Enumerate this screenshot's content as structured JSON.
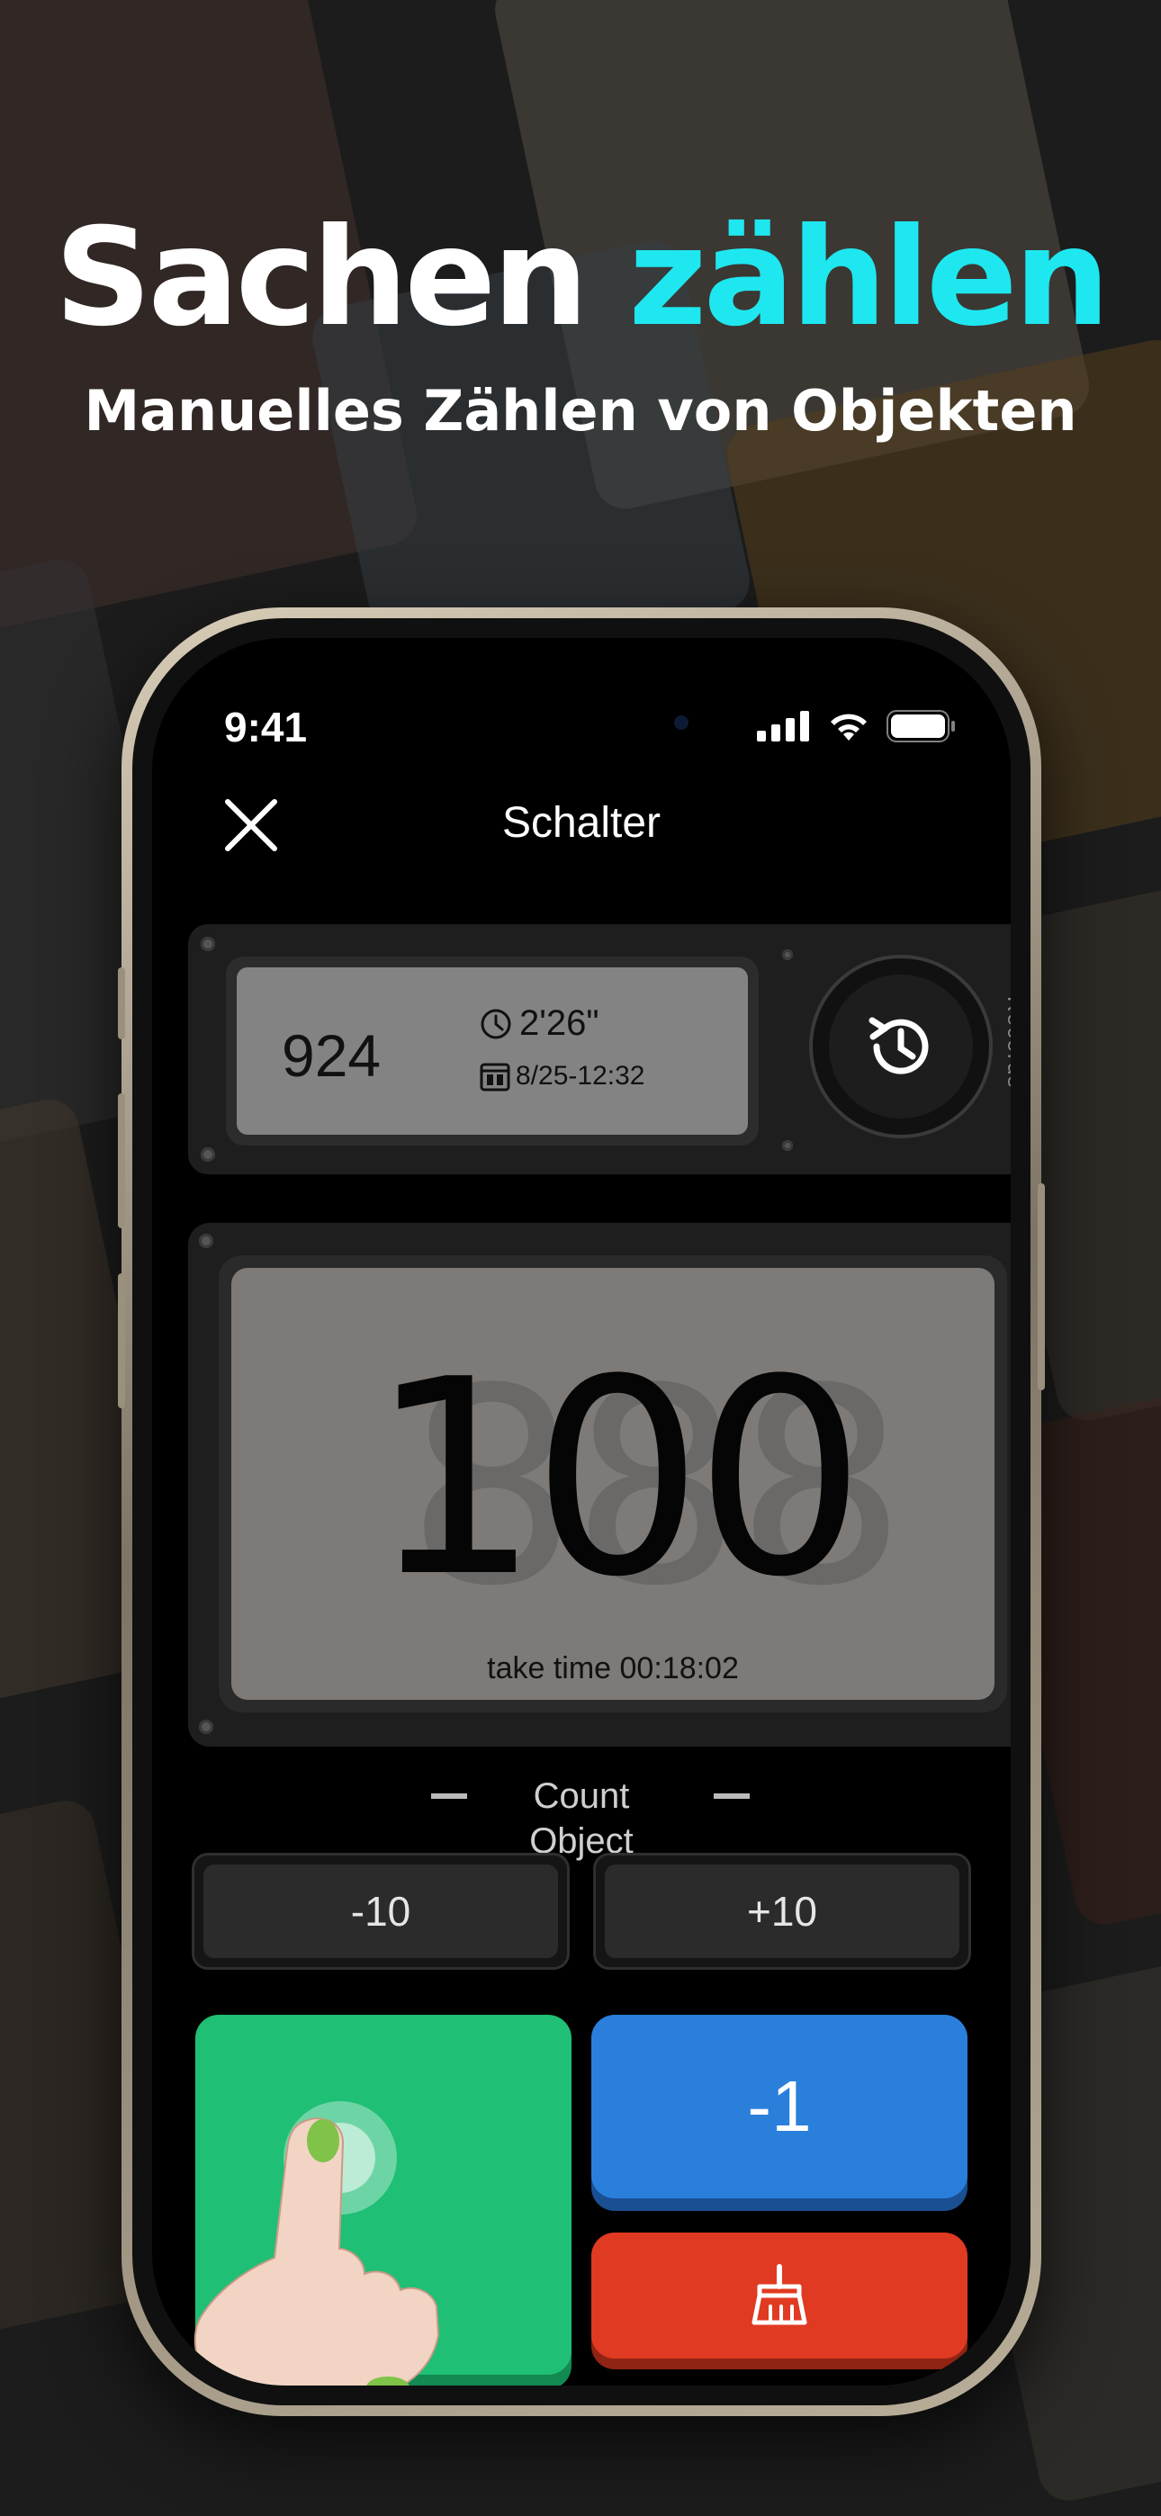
{
  "headline": {
    "part1": "Sachen",
    "part2": "zählen"
  },
  "subline": "Manuelles Zählen von Objekten",
  "status_bar": {
    "time": "9:41"
  },
  "nav": {
    "title": "Schalter"
  },
  "records": {
    "count": "924",
    "duration": "2'26\"",
    "date": "8/25-12:32",
    "label": "Records"
  },
  "display": {
    "count": "100",
    "take_time": "take time 00:18:02"
  },
  "mode": {
    "label": "Count Object"
  },
  "buttons": {
    "minus_ten": "-10",
    "plus_ten": "+10",
    "minus_one": "-1"
  },
  "colors": {
    "accent": "#1fe7ef",
    "green": "#1fbf75",
    "blue": "#2a7fdb",
    "red": "#e03a22"
  }
}
